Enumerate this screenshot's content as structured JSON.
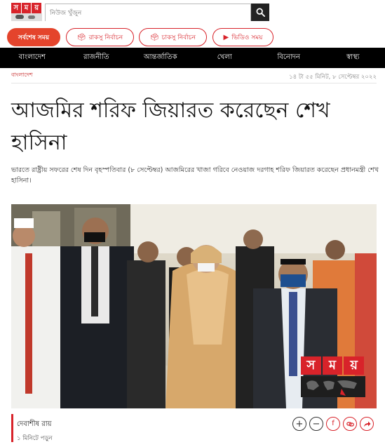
{
  "logo": {
    "letters": [
      "স",
      "ম",
      "য়"
    ]
  },
  "search": {
    "placeholder": "নিউজ খুঁজুন"
  },
  "pills": [
    {
      "label": "সর্বশেষ সময়",
      "icon": ""
    },
    {
      "label": "রাকসু নির্বাচন",
      "icon": "ballot-icon"
    },
    {
      "label": "চাকসু নির্বাচন",
      "icon": "ballot-icon"
    },
    {
      "label": "ভিডিও সময়",
      "icon": "play-icon"
    }
  ],
  "nav": [
    "বাংলাদেশ",
    "রাজনীতি",
    "আন্তর্জাতিক",
    "খেলা",
    "বিনোদন",
    "স্বাস্থ্য"
  ],
  "breadcrumb": "বাংলাদেশ",
  "date": "১৪ টা ৫৫ মিনিট, ৮ সেপ্টেম্বর ২০২২",
  "headline": "আজমির শরিফ জিয়ারত করেছেন শেখ হাসিনা",
  "summary": "ভারতে রাষ্ট্রীয় সফরের শেষ দিন বৃহস্পতিবার (৮ সেপ্টেম্বর) আজমিরের খাজা গরিবে নেওয়াজ দরগাহ শরিফ জিয়ারত করেছেন প্রধানমন্ত্রী শেখ হাসিনা।",
  "watermark": {
    "letters": [
      "স",
      "ম",
      "য়"
    ]
  },
  "author": {
    "name": "দেবাশীষ রায়",
    "read_time": "১ মিনিটে পড়ুন"
  },
  "actions": [
    {
      "name": "zoom-in-icon",
      "glyph": "+"
    },
    {
      "name": "zoom-out-icon",
      "glyph": "−"
    },
    {
      "name": "facebook-icon",
      "glyph": "f"
    },
    {
      "name": "copy-link-icon",
      "glyph": "⛓"
    },
    {
      "name": "share-icon",
      "glyph": "➦"
    }
  ],
  "colors": {
    "accent": "#d8232a",
    "nav_bg": "#000000"
  }
}
